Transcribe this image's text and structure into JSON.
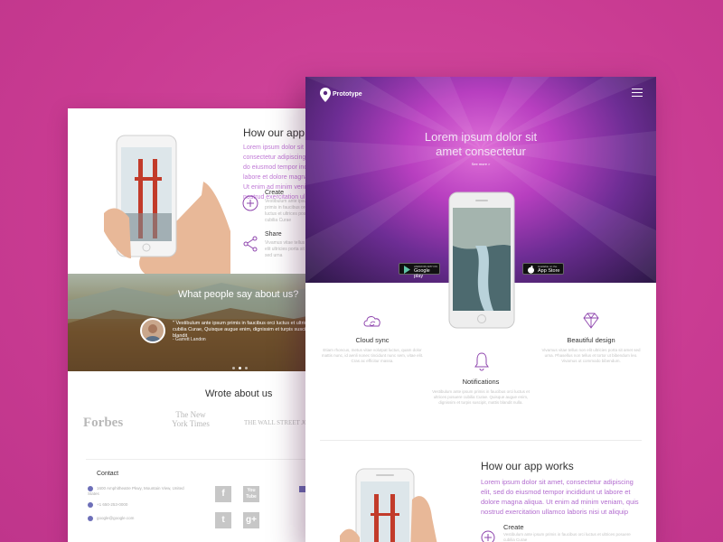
{
  "back_page": {
    "how_title": "How our app",
    "how_text": "Lorem ipsum dolor sit amet, consectetur adipiscing elit, sed do eiusmod tempor incididunt ut labore et dolore magna aliqua. Ut enim ad minim veniam, quis nostrud exercitation ullamco",
    "features": [
      {
        "icon": "plus-circle-icon",
        "title": "Create",
        "text": "Vestibulum ante ipsum primis in faucibus orci luctus et ultrices posuere cubilia Curae"
      },
      {
        "icon": "share-icon",
        "title": "Share",
        "text": "Vivamus vitae tellus non elit ultricies porta sit amet sed urna"
      }
    ],
    "testimonial": {
      "title": "What people say about us?",
      "quote": "\" Vestibulum ante ipsum primis in faucibus orci luctus et ultrices posuere cubilia Curae, Quisque augue enim, dignissim et turpis suscipit, mattis blandit",
      "author": "- Garrett Landon"
    },
    "wrote_about": "Wrote about us",
    "press_logos": [
      "Forbes",
      "The New York Times",
      "THE WALL STREET JOURNAL"
    ],
    "contact": {
      "title": "Contact",
      "address": "1600 Amphitheatre Pkwy, Mountain View, United States",
      "phone": "+1 650-253-0000",
      "email": "google@google.com"
    },
    "social": [
      "f",
      "You Tube",
      "t",
      "g+"
    ]
  },
  "front_page": {
    "brand": "Prototype",
    "hero_title_line1": "Lorem ipsum dolor sit",
    "hero_title_line2": "amet consectetur",
    "see_more": "See more >",
    "badges": [
      {
        "small": "ANDROID APP ON",
        "big": "Google play",
        "icon": "google-play-icon"
      },
      {
        "small": "Available on the",
        "big": "App Store",
        "icon": "apple-icon"
      }
    ],
    "features": [
      {
        "icon": "cloud-sync-icon",
        "title": "Cloud sync",
        "text": "Etiam rhoncus, metus vitae volutpat luctus, quam dolor mattis nunc, id aenli nonec tincidunt nunc sem, vitae elit. Cras ac efficitur massa."
      },
      {
        "icon": "bell-icon",
        "title": "Notifications",
        "text": "Vestibulum ante ipsum primis in faucibus orci luctus et ultrices posuere cubilia Curae. Quisque augue enim, dignissim et turpis suscipit, mattis blandit nulla."
      },
      {
        "icon": "diamond-icon",
        "title": "Beautiful design",
        "text": "Vivamus vitae tellus non elit ultricies porta sit amet sed urna. Phasellus non tellus et tortor ut bibendum leo. Vivamus ut commodo bibendum."
      }
    ],
    "how_title": "How our app works",
    "how_text": "Lorem ipsum dolor sit amet, consectetur adipiscing elit, sed do eiusmod tempor incididunt ut labore et dolore magna aliqua. Ut enim ad minim veniam, quis nostrud exercitation ullamco laboris nisi ut aliquip",
    "create_title": "Create",
    "create_text": "Vestibulum ante ipsum primis in faucibus orci luctus et ultrices posuere cubilia Curae"
  },
  "colors": {
    "background": "#cf3f98",
    "accent_purple": "#8e44ad",
    "lorem_text": "#b26ccf"
  }
}
